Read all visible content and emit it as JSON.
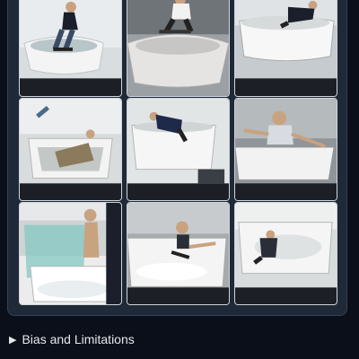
{
  "gallery": {
    "images": [
      {
        "subject": "skateboarder-in-bathtub"
      },
      {
        "subject": "skateboarder-in-bathtub"
      },
      {
        "subject": "skateboarder-in-bathtub"
      },
      {
        "subject": "skateboarder-in-bathtub"
      },
      {
        "subject": "skateboarder-in-bathtub"
      },
      {
        "subject": "skateboarder-in-bathtub"
      },
      {
        "subject": "skateboarder-in-bathtub"
      },
      {
        "subject": "skateboarder-in-bathtub"
      },
      {
        "subject": "skateboarder-in-bathtub"
      }
    ]
  },
  "accordion": {
    "icon": "triangle-right-icon",
    "label": "Bias and Limitations"
  }
}
